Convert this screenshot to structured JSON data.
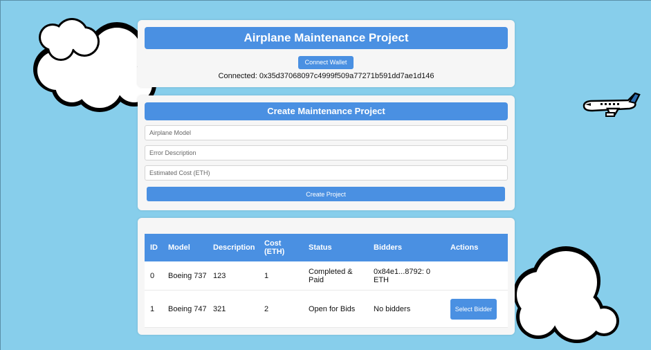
{
  "header": {
    "title": "Airplane Maintenance Project",
    "connect_button": "Connect Wallet",
    "connected_text": "Connected: 0x35d37068097c4999f509a77271b591dd7ae1d146"
  },
  "create_form": {
    "title": "Create Maintenance Project",
    "model_placeholder": "Airplane Model",
    "description_placeholder": "Error Description",
    "cost_placeholder": "Estimated Cost (ETH)",
    "submit_label": "Create Project"
  },
  "projects_table": {
    "columns": [
      "ID",
      "Model",
      "Description",
      "Cost (ETH)",
      "Status",
      "Bidders",
      "Actions"
    ],
    "rows": [
      {
        "id": "0",
        "model": "Boeing 737",
        "description": "123",
        "cost": "1",
        "status": "Completed & Paid",
        "bidders": "0x84e1...8792: 0 ETH",
        "action": ""
      },
      {
        "id": "1",
        "model": "Boeing 747",
        "description": "321",
        "cost": "2",
        "status": "Open for Bids",
        "bidders": "No bidders",
        "action": "Select Bidder"
      }
    ]
  },
  "colors": {
    "background": "#87ceeb",
    "accent": "#4a90e2",
    "status_completed": "#28a745"
  },
  "icons": [
    "cloud-icon",
    "airplane-icon"
  ]
}
